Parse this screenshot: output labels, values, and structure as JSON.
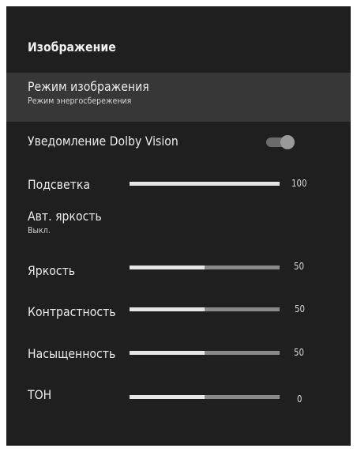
{
  "panel": {
    "title": "Изображение"
  },
  "items": {
    "picture_mode": {
      "label": "Режим изображения",
      "value": "Режим энергосбережения"
    },
    "dolby_vision": {
      "label": "Уведомление Dolby Vision",
      "toggle_on": true
    },
    "backlight": {
      "label": "Подсветка",
      "value": "100",
      "level": 100
    },
    "auto_brightness": {
      "label": "Авт. яркость",
      "value": "Выкл."
    },
    "brightness": {
      "label": "Яркость",
      "value": "50",
      "level": 50
    },
    "contrast": {
      "label": "Контрастность",
      "value": "50",
      "level": 50
    },
    "saturation": {
      "label": "Насыщенность",
      "value": "50",
      "level": 50
    },
    "tint": {
      "label": "ТОН",
      "value": "0",
      "level": 50
    }
  },
  "colors": {
    "panel_bg": "#1f1f1f",
    "selected_bg": "#373737",
    "slider_fill": "#e6e6e6",
    "slider_track": "#8a8a8a"
  }
}
